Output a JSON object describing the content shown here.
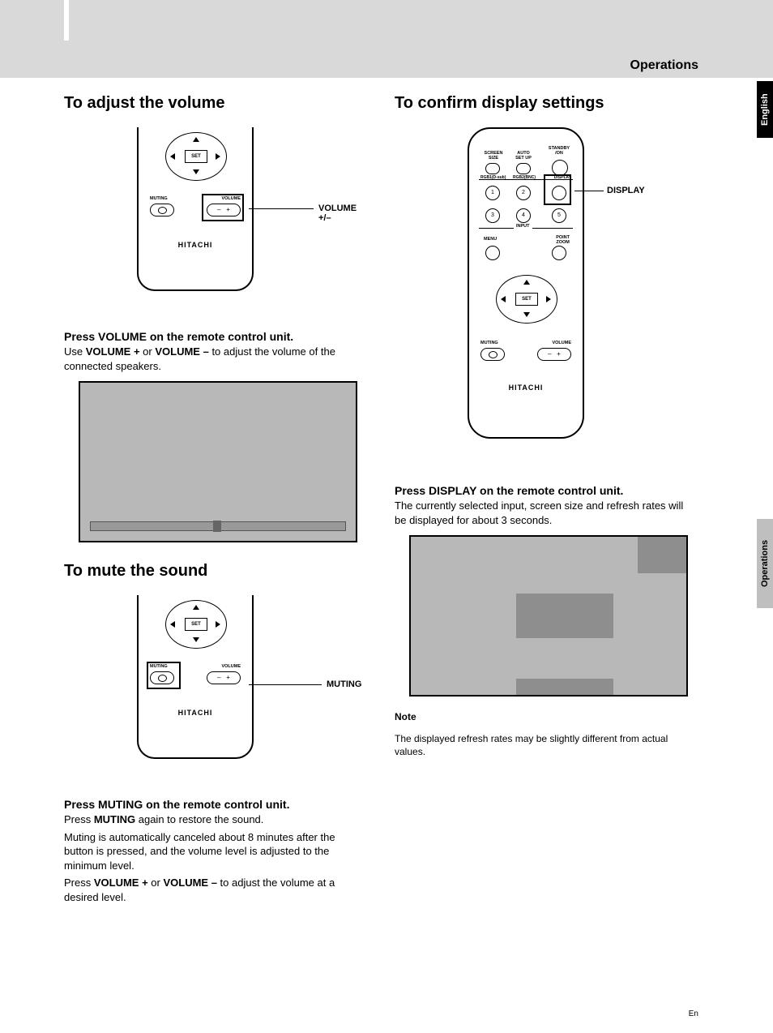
{
  "header": {
    "section": "Operations"
  },
  "side_tabs": {
    "lang": "English",
    "section": "Operations"
  },
  "left_col": {
    "h_volume": "To adjust the volume",
    "callout_volume": "VOLUME +/–",
    "brand": "HITACHI",
    "set_label": "SET",
    "muting_label": "MUTING",
    "volume_label": "VOLUME",
    "vol_instr_head": "Press VOLUME on the remote control unit.",
    "vol_instr_body_pre": "Use ",
    "vol_plus": "VOLUME +",
    "vol_or": " or ",
    "vol_minus": "VOLUME –",
    "vol_instr_body_post": " to adjust the volume of the connected speakers.",
    "h_mute": "To mute the sound",
    "callout_muting": "MUTING",
    "mute_instr_head": "Press MUTING on the remote control unit.",
    "mute_body_pre": "Press ",
    "mute_word": "MUTING",
    "mute_body_post": " again to restore the sound.",
    "mute_body2": "Muting is automatically canceled about 8 minutes after the button is pressed, and the volume level is adjusted to the minimum level.",
    "mute_body3_pre": "Press ",
    "mute_body3_post": " to adjust the volume at a desired level."
  },
  "right_col": {
    "h_display": "To confirm display settings",
    "callout_display": "DISPLAY",
    "remote_labels": {
      "screen_size": "SCREEN\nSIZE",
      "auto_setup": "AUTO\nSET UP",
      "standby": "STANDBY\n/ON",
      "rgb1": "RGB1(D-sub)",
      "rgb2": "RGB2(BNC)",
      "display": "DISPLAY",
      "input": "INPUT",
      "menu": "MENU",
      "point_zoom": "POINT\nZOOM",
      "set": "SET",
      "muting": "MUTING",
      "volume": "VOLUME",
      "brand": "HITACHI",
      "n1": "1",
      "n2": "2",
      "n3": "3",
      "n4": "4",
      "n5": "5"
    },
    "disp_instr_head": "Press DISPLAY on the remote control unit.",
    "disp_instr_body": "The currently selected input, screen size and refresh rates will be displayed for about 3 seconds.",
    "note_head": "Note",
    "note_body": "The displayed refresh rates may be slightly different from actual values."
  },
  "footer": {
    "lang_code": "En"
  }
}
